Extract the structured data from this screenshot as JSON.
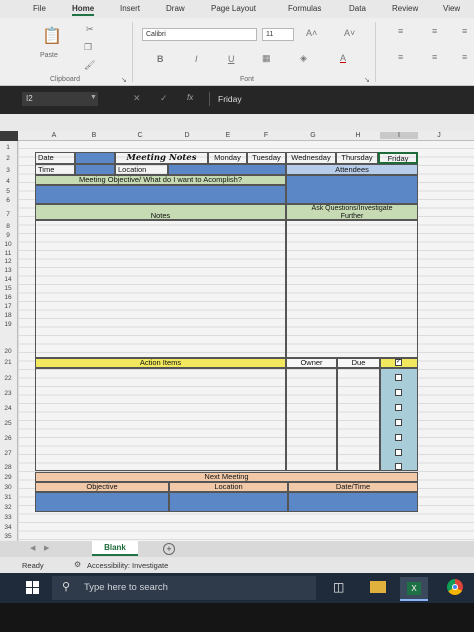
{
  "ribbon": {
    "tabs": [
      "File",
      "Home",
      "Insert",
      "Draw",
      "Page Layout",
      "Formulas",
      "Data",
      "Review",
      "View"
    ],
    "active_tab": "Home",
    "paste_label": "Paste",
    "clipboard_label": "Clipboard",
    "font_name": "Calibri",
    "font_size": "11",
    "font_group_label": "Font",
    "bold_label": "B",
    "italic_label": "I",
    "underline_label": "U",
    "grow_font_label": "A˄",
    "shrink_font_label": "A˅",
    "font_color_label": "A"
  },
  "formula_bar": {
    "name_box": "I2",
    "fx_label": "fx",
    "content": "Friday"
  },
  "columns": [
    "A",
    "B",
    "C",
    "D",
    "E",
    "F",
    "G",
    "H",
    "I",
    "J"
  ],
  "rows": [
    "1",
    "2",
    "3",
    "4",
    "5",
    "6",
    "7",
    "8",
    "9",
    "10",
    "11",
    "12",
    "13",
    "14",
    "15",
    "16",
    "17",
    "18",
    "19",
    "20",
    "21",
    "22",
    "23",
    "24",
    "25",
    "26",
    "27",
    "28",
    "29",
    "30",
    "31",
    "32",
    "33",
    "34",
    "35"
  ],
  "sheet": {
    "date_label": "Date",
    "title": "Meeting Notes",
    "days": [
      "Monday",
      "Tuesday",
      "Wednesday",
      "Thursday",
      "Friday"
    ],
    "time_label": "Time",
    "location_label": "Location",
    "attendees_label": "Attendees",
    "objective_label": "Meeting Objective/ What do I want to Acomplish?",
    "ask_label_1": "Ask Questions/Investigate",
    "ask_label_2": "Further",
    "notes_label": "Notes",
    "action_items_label": "Action Items",
    "owner_label": "Owner",
    "due_label": "Due",
    "next_meeting_label": "Next Meeting",
    "objective_col_label": "Objective",
    "location_col_label": "Location",
    "datetime_col_label": "Date/Time"
  },
  "sheet_tabs": {
    "active": "Blank",
    "add": "+"
  },
  "status": {
    "ready": "Ready",
    "accessibility": "Accessibility: Investigate"
  },
  "taskbar": {
    "search_placeholder": "Type here to search"
  }
}
